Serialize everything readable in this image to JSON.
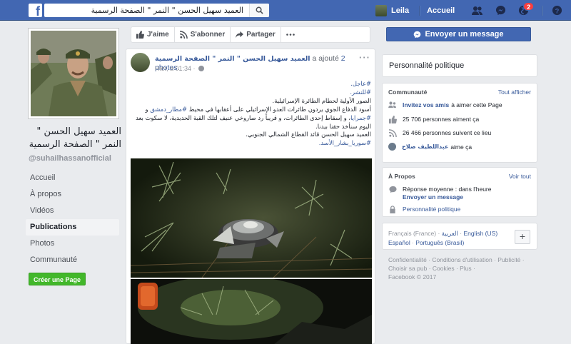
{
  "topbar": {
    "logo": "f",
    "search_value": "العميد سهيل الحسن \" النمر \" الصفحة الرسمية",
    "user_name": "Leila",
    "home_label": "Accueil",
    "notifications_count": "2"
  },
  "page": {
    "name": "العميد سهيل الحسن \" النمر \" الصفحة الرسمية",
    "handle": "@suhailhassanofficial"
  },
  "left_nav": [
    {
      "label": "Accueil"
    },
    {
      "label": "À propos"
    },
    {
      "label": "Vidéos"
    },
    {
      "label": "Publications"
    },
    {
      "label": "Photos"
    },
    {
      "label": "Communauté"
    }
  ],
  "create_page_label": "Créer une Page",
  "actions": {
    "like": "J'aime",
    "follow": "S'abonner",
    "share": "Partager",
    "send_message": "Envoyer un message"
  },
  "post": {
    "author": "العميد سهيل الحسن \" النمر \" الصفحة الرسمية",
    "action": "a ajouté",
    "photos_link": "2 photos",
    "time": "Hier, à 01:34 ·",
    "lines": {
      "l1": "#عاجل.",
      "l2": "#للنشر.",
      "l3": "الصور الأولية لحطام الطائرة الإسرائيلية.",
      "l4a": "أسود الدفاع الجوي يردون طائرات العدو الإسرائيلي على أعقابها في محيط ",
      "l4tag": "#مطار_دمشق",
      "l4b": " و",
      "l5tag": "#جمرايا",
      "l5b": "، و إسقاط إحدى الطائرات، و قريباً رد صاروخي عنيف لتلك القبة الحديدية، لا سكوت بعد",
      "l6": "اليوم سنأخذ حقنا بيدنا.",
      "l7": "العميد سهيل الحسن قائد القطاع الشمالي الجنوبي.",
      "l8": "#سوريا_بشار_الأسد."
    }
  },
  "right": {
    "category": "Personnalité politique",
    "community": {
      "title": "Communauté",
      "see_all": "Tout afficher",
      "invite_link": "Invitez vos amis",
      "invite_text": "à aimer cette Page",
      "likes": "25 706 personnes aiment ça",
      "follows": "26 466 personnes suivent ce lieu",
      "friend_name": "عبداللطيف صلاح",
      "friend_text": "aime ça"
    },
    "about": {
      "title": "À Propos",
      "see_all": "Voir tout",
      "response": "Réponse moyenne : dans l'heure",
      "send_message": "Envoyer un message",
      "category": "Personnalité politique"
    },
    "languages": {
      "current": "Français (France)",
      "arabic": "العربية",
      "english": "English (US)",
      "spanish": "Español",
      "portuguese": "Português (Brasil)",
      "plus": "+"
    },
    "footer": {
      "l1": "Confidentialité · Conditions d'utilisation · Publicité ·",
      "l2": "Choisir sa pub · Cookies · Plus ·",
      "l3": "Facebook © 2017"
    }
  }
}
